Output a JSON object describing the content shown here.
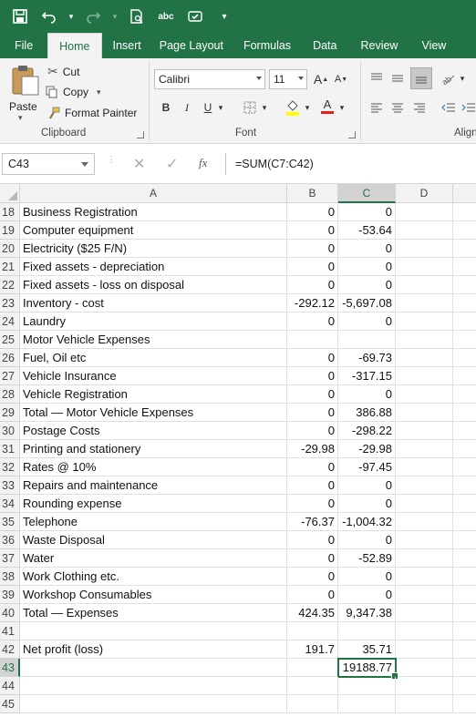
{
  "qat": {
    "icons": [
      "save-icon",
      "undo-icon",
      "redo-icon",
      "print-preview-icon",
      "spelling-icon",
      "touch-mode-icon",
      "customize-qat-icon"
    ],
    "spell_text": "abc"
  },
  "tabs": [
    "File",
    "Home",
    "Insert",
    "Page Layout",
    "Formulas",
    "Data",
    "Review",
    "View"
  ],
  "active_tab": "Home",
  "ribbon": {
    "clipboard": {
      "paste_label": "Paste",
      "cut_label": "Cut",
      "copy_label": "Copy",
      "format_painter_label": "Format Painter",
      "group_label": "Clipboard"
    },
    "font": {
      "font_name": "Calibri",
      "font_size": "11",
      "bold": "B",
      "italic": "I",
      "underline": "U",
      "grow_font": "A",
      "shrink_font": "A",
      "font_color_letter": "A",
      "group_label": "Font"
    },
    "alignment": {
      "group_label": "Align"
    }
  },
  "formula_bar": {
    "name_box": "C43",
    "fx": "fx",
    "formula": "=SUM(C7:C42)"
  },
  "columns": [
    "A",
    "B",
    "C",
    "D"
  ],
  "selected_column": "C",
  "rows": [
    {
      "n": "18",
      "a": "Business Registration",
      "b": "0",
      "c": "0"
    },
    {
      "n": "19",
      "a": "Computer equipment",
      "b": "0",
      "c": "-53.64"
    },
    {
      "n": "20",
      "a": "Electricity ($25 F/N)",
      "b": "0",
      "c": "0"
    },
    {
      "n": "21",
      "a": "Fixed assets - depreciation",
      "b": "0",
      "c": "0"
    },
    {
      "n": "22",
      "a": "Fixed assets - loss on disposal",
      "b": "0",
      "c": "0"
    },
    {
      "n": "23",
      "a": "Inventory - cost",
      "b": "-292.12",
      "c": "-5,697.08"
    },
    {
      "n": "24",
      "a": "Laundry",
      "b": "0",
      "c": "0"
    },
    {
      "n": "25",
      "a": "Motor Vehicle Expenses",
      "b": "",
      "c": ""
    },
    {
      "n": "26",
      "a": "Fuel, Oil etc",
      "b": "0",
      "c": "-69.73"
    },
    {
      "n": "27",
      "a": "Vehicle Insurance",
      "b": "0",
      "c": "-317.15"
    },
    {
      "n": "28",
      "a": "Vehicle Registration",
      "b": "0",
      "c": "0"
    },
    {
      "n": "29",
      "a": "Total — Motor Vehicle Expenses",
      "b": "0",
      "c": "386.88"
    },
    {
      "n": "30",
      "a": "Postage Costs",
      "b": "0",
      "c": "-298.22"
    },
    {
      "n": "31",
      "a": "Printing and stationery",
      "b": "-29.98",
      "c": "-29.98"
    },
    {
      "n": "32",
      "a": "Rates @ 10%",
      "b": "0",
      "c": "-97.45"
    },
    {
      "n": "33",
      "a": "Repairs and maintenance",
      "b": "0",
      "c": "0"
    },
    {
      "n": "34",
      "a": "Rounding expense",
      "b": "0",
      "c": "0"
    },
    {
      "n": "35",
      "a": "Telephone",
      "b": "-76.37",
      "c": "-1,004.32"
    },
    {
      "n": "36",
      "a": "Waste Disposal",
      "b": "0",
      "c": "0"
    },
    {
      "n": "37",
      "a": "Water",
      "b": "0",
      "c": "-52.89"
    },
    {
      "n": "38",
      "a": "Work Clothing etc.",
      "b": "0",
      "c": "0"
    },
    {
      "n": "39",
      "a": "Workshop Consumables",
      "b": "0",
      "c": "0"
    },
    {
      "n": "40",
      "a": "Total — Expenses",
      "b": "424.35",
      "c": "9,347.38"
    },
    {
      "n": "41",
      "a": "",
      "b": "",
      "c": ""
    },
    {
      "n": "42",
      "a": "Net profit (loss)",
      "b": "191.7",
      "c": "35.71"
    },
    {
      "n": "43",
      "a": "",
      "b": "",
      "c": "19188.77"
    },
    {
      "n": "44",
      "a": "",
      "b": "",
      "c": ""
    },
    {
      "n": "45",
      "a": "",
      "b": "",
      "c": ""
    }
  ],
  "active_row": "43",
  "colors": {
    "excel_green": "#217346",
    "ribbon_bg": "#f3f3f3"
  }
}
